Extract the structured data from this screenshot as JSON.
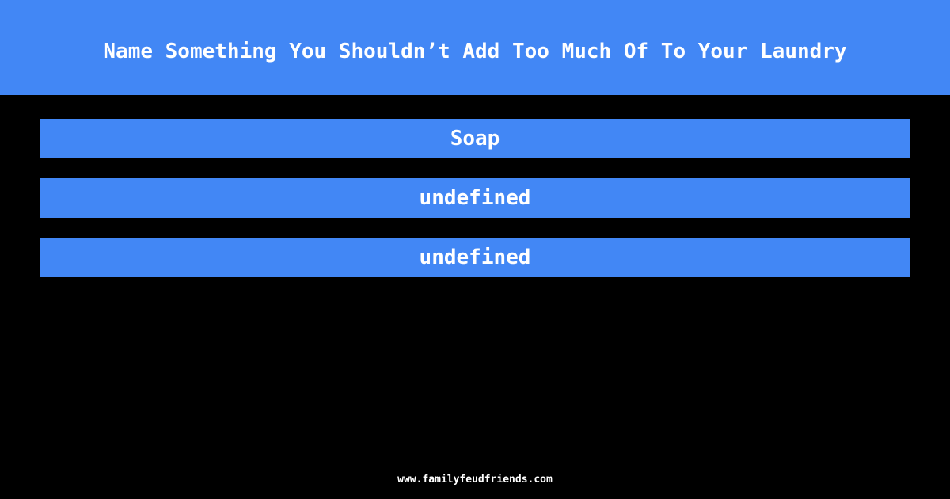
{
  "header": {
    "title": "Name Something You Shouldn’t Add Too Much Of To Your Laundry"
  },
  "answers": [
    {
      "text": "Soap"
    },
    {
      "text": "undefined"
    },
    {
      "text": "undefined"
    }
  ],
  "footer": {
    "site": "www.familyfeudfriends.com"
  },
  "colors": {
    "accent": "#4287f5",
    "background": "#000000",
    "text": "#ffffff"
  }
}
